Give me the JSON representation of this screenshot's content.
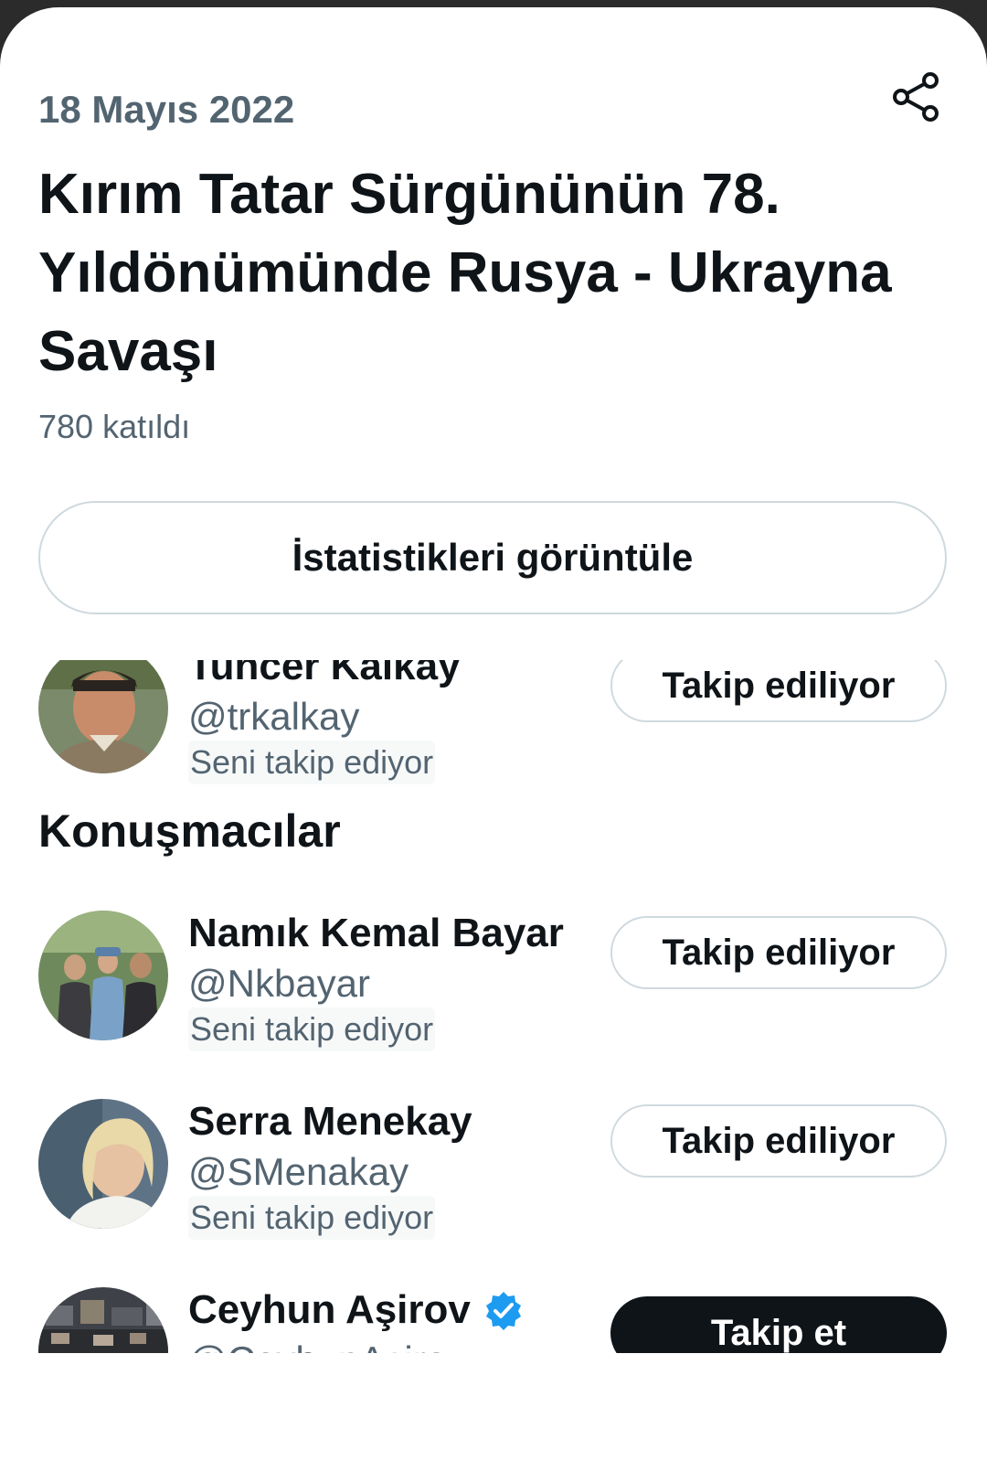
{
  "space": {
    "date": "18 Mayıs 2022",
    "title": "Kırım Tatar Sürgününün 78. Yıldönümünde Rusya - Ukrayna Savaşı",
    "participants": "780 katıldı",
    "stats_button": "İstatistikleri görüntüle",
    "share_icon": "share-icon"
  },
  "host": {
    "name": "Tuncer Kalkay",
    "handle": "@trkalkay",
    "follows_you": "Seni takip ediyor",
    "button": "Takip ediliyor"
  },
  "speakers": {
    "heading": "Konuşmacılar",
    "items": [
      {
        "name": "Namık Kemal Bayar",
        "handle": "@Nkbayar",
        "follows_you": "Seni takip ediyor",
        "button": "Takip ediliyor"
      },
      {
        "name": "Serra Menekay",
        "handle": "@SMenakay",
        "follows_you": "Seni takip ediyor",
        "button": "Takip ediliyor"
      },
      {
        "name": "Ceyhun Aşirov",
        "handle": "@CeyhunAsirov",
        "verified": true,
        "button": "Takip et"
      }
    ]
  },
  "colors": {
    "primary_text": "#0f1419",
    "secondary_text": "#536471",
    "border": "#cfd9de",
    "verified": "#1d9bf0"
  }
}
